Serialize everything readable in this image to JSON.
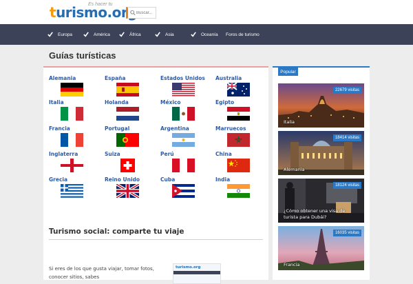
{
  "header": {
    "logo_part1": "t",
    "logo_part2": "urismo.org",
    "logo_tagline": "Es hacer tu",
    "search_placeholder": "Buscar..."
  },
  "nav": {
    "items": [
      {
        "label": "Europa",
        "checked": true
      },
      {
        "label": "América",
        "checked": true
      },
      {
        "label": "África",
        "checked": true
      },
      {
        "label": "Asia",
        "checked": true
      },
      {
        "label": "Oceanía",
        "checked": true
      },
      {
        "label": "Foros de turismo",
        "checked": false
      }
    ]
  },
  "page_title": "Guías turísticas",
  "countries": [
    {
      "name": "Alemania",
      "flag": "germany"
    },
    {
      "name": "España",
      "flag": "spain"
    },
    {
      "name": "Estados Unidos",
      "flag": "usa"
    },
    {
      "name": "Australia",
      "flag": "australia"
    },
    {
      "name": "Italia",
      "flag": "italy"
    },
    {
      "name": "Holanda",
      "flag": "netherlands"
    },
    {
      "name": "México",
      "flag": "mexico"
    },
    {
      "name": "Egipto",
      "flag": "egypt"
    },
    {
      "name": "Francia",
      "flag": "france"
    },
    {
      "name": "Portugal",
      "flag": "portugal"
    },
    {
      "name": "Argentina",
      "flag": "argentina"
    },
    {
      "name": "Marruecos",
      "flag": "morocco"
    },
    {
      "name": "Inglaterra",
      "flag": "england"
    },
    {
      "name": "Suiza",
      "flag": "switzerland"
    },
    {
      "name": "Perú",
      "flag": "peru"
    },
    {
      "name": "China",
      "flag": "china"
    },
    {
      "name": "Grecia",
      "flag": "greece"
    },
    {
      "name": "Reino Unido",
      "flag": "uk"
    },
    {
      "name": "Cuba",
      "flag": "cuba"
    },
    {
      "name": "India",
      "flag": "india"
    }
  ],
  "social": {
    "title": "Turismo social: comparte tu viaje",
    "text": "Si eres de los que gusta viajar, tomar fotos, conocer sitios, sabes",
    "thumb_logo": "turismo.org"
  },
  "sidebar": {
    "tab_label": "Popular",
    "items": [
      {
        "visits": "22679 visitas",
        "caption": "Italia",
        "scene": "rome"
      },
      {
        "visits": "18414 visitas",
        "caption": "Alemania",
        "scene": "berlin"
      },
      {
        "visits": "18124 visitas",
        "caption": "¿Cómo obtener una visa de turista para Dubái?",
        "scene": "dubai"
      },
      {
        "visits": "16035 visitas",
        "caption": "Francia",
        "scene": "paris"
      }
    ]
  },
  "colors": {
    "nav_bg": "#3c4358",
    "link_blue": "#2b5aa8",
    "accent_blue": "#2b78c5",
    "logo_orange": "#f39c12"
  }
}
